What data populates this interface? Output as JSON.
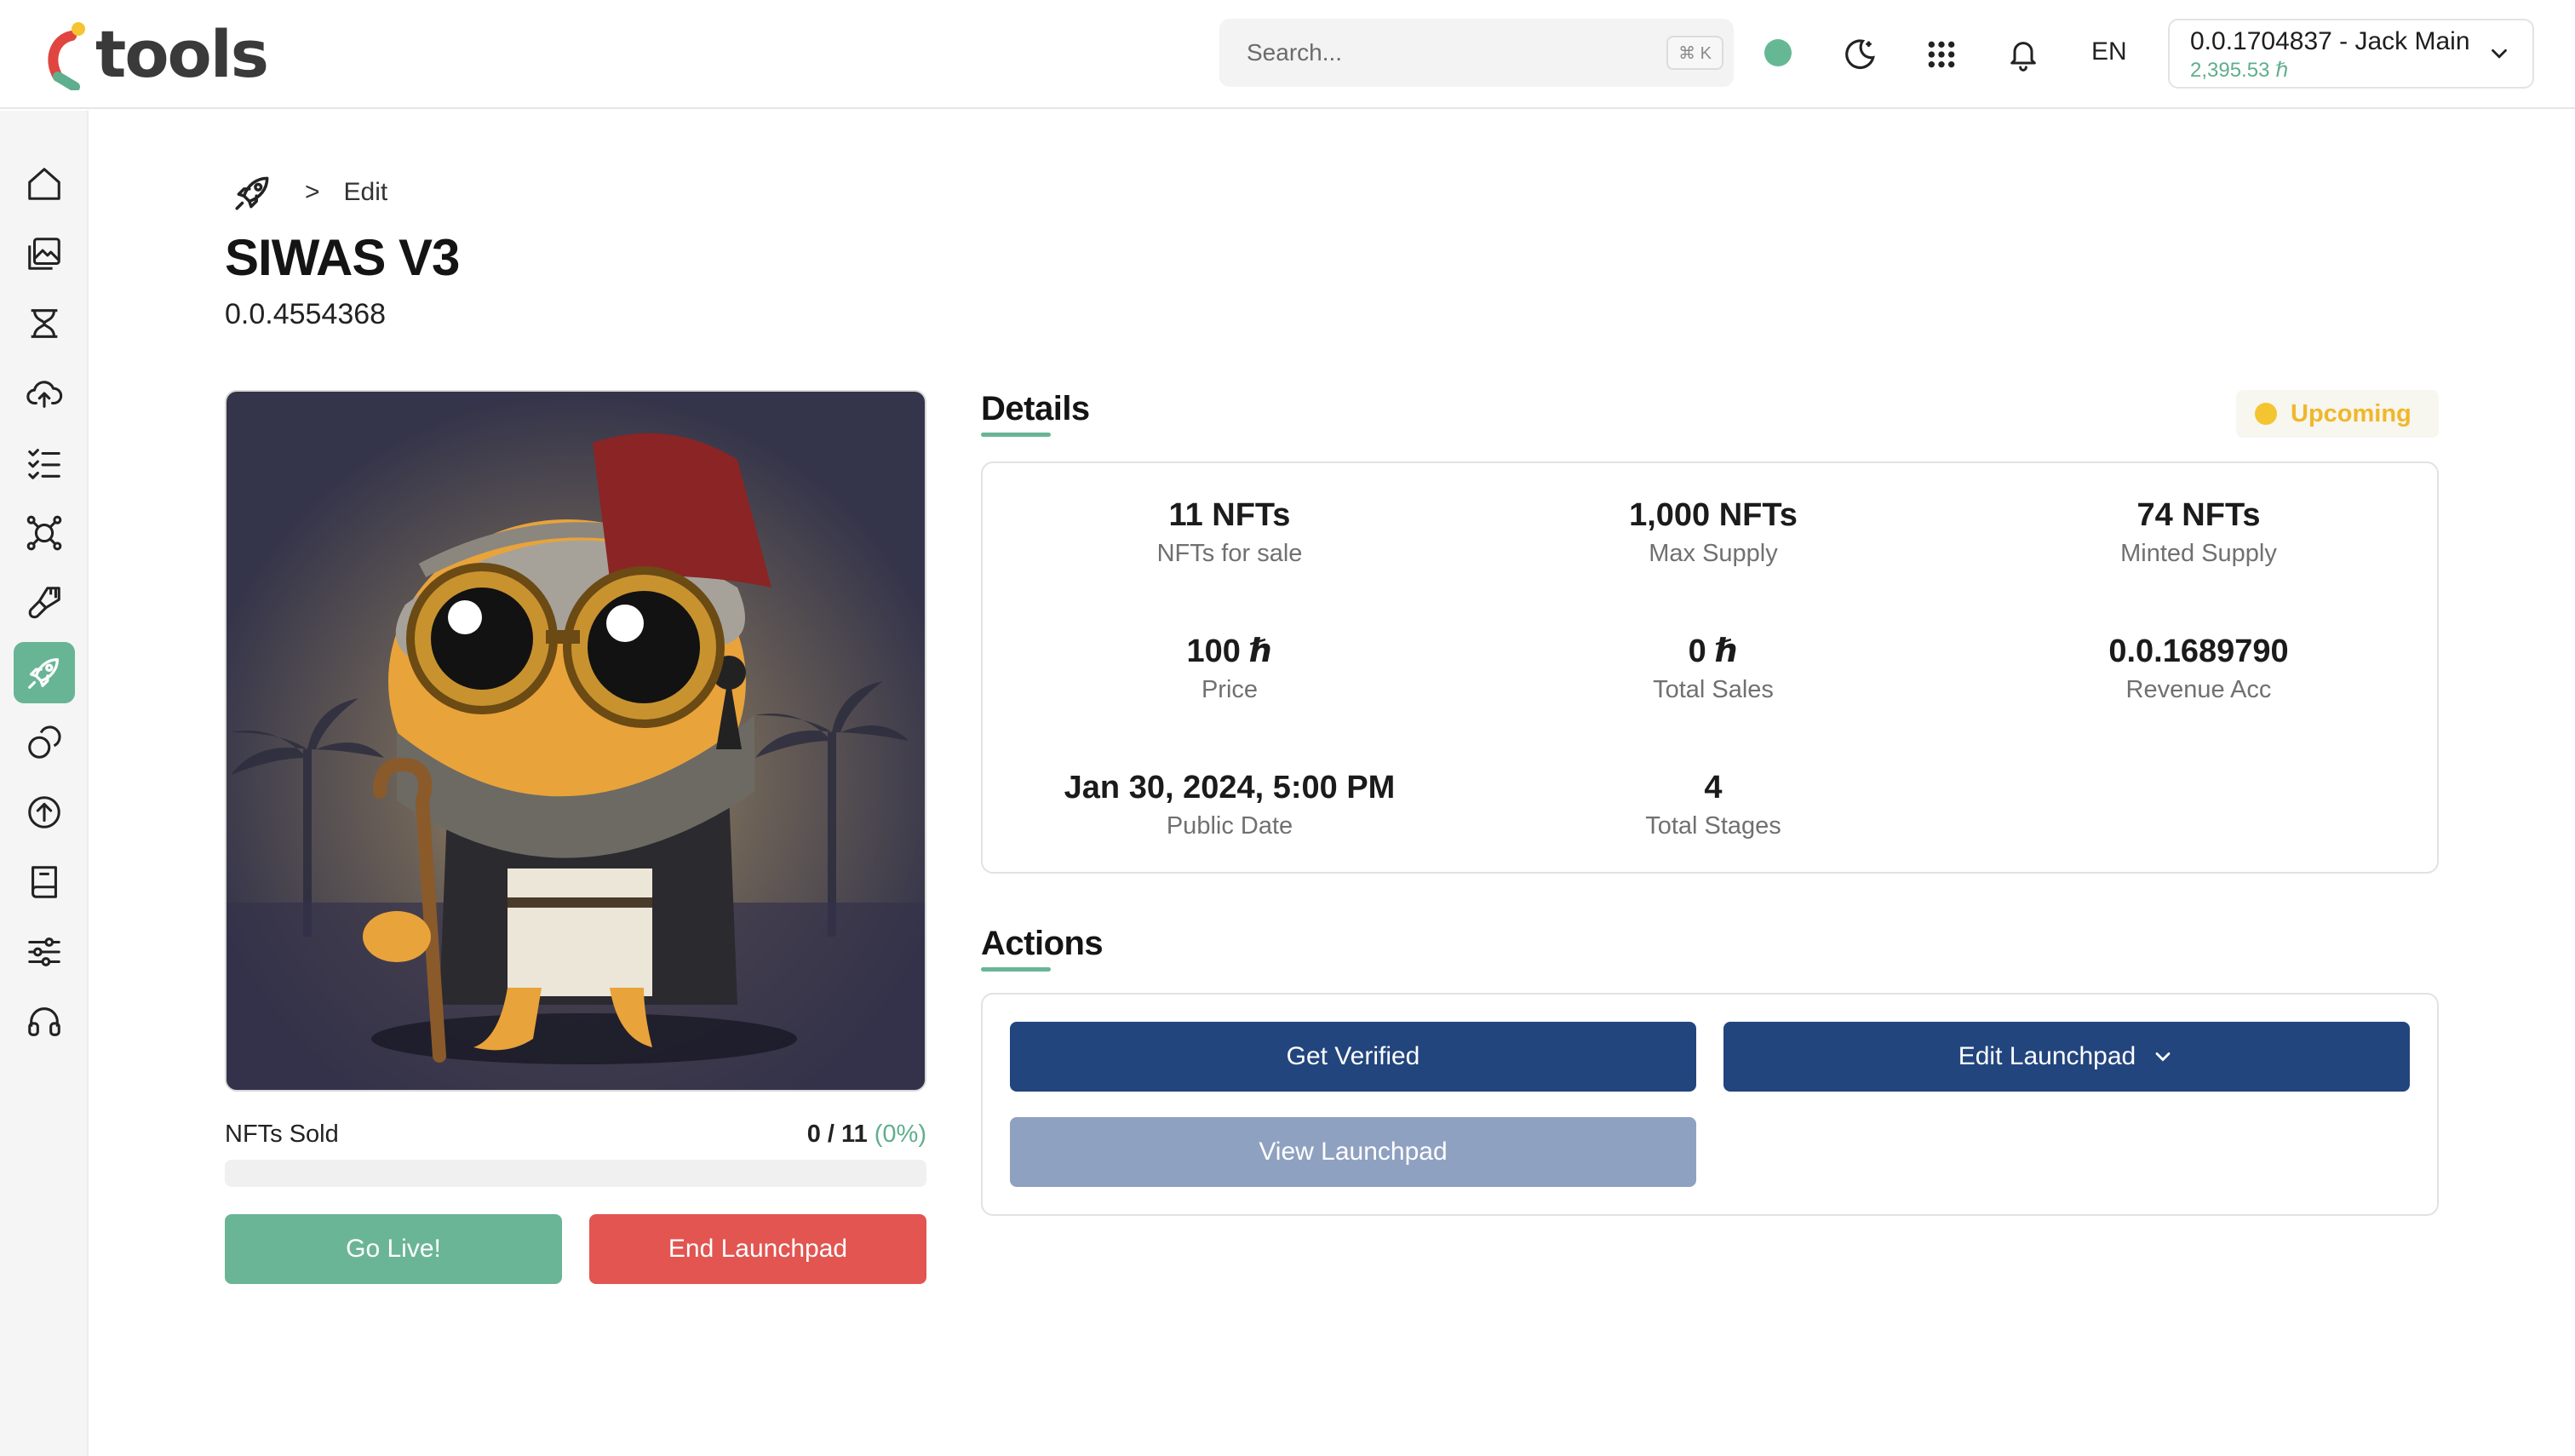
{
  "header": {
    "logo_text": "tools",
    "search_placeholder": "Search...",
    "search_shortcut": "⌘ K",
    "language": "EN",
    "account_name": "0.0.1704837 - Jack Main",
    "account_balance": "2,395.53 ℏ",
    "status_color": "#66b895"
  },
  "sidebar": {
    "items": [
      {
        "icon": "home-icon"
      },
      {
        "icon": "gallery-icon"
      },
      {
        "icon": "hourglass-icon"
      },
      {
        "icon": "cloud-upload-icon"
      },
      {
        "icon": "checklist-icon"
      },
      {
        "icon": "network-icon"
      },
      {
        "icon": "brush-icon"
      },
      {
        "icon": "rocket-icon",
        "active": true
      },
      {
        "icon": "coins-icon"
      },
      {
        "icon": "arrow-up-circle-icon"
      },
      {
        "icon": "book-icon"
      },
      {
        "icon": "sliders-icon"
      },
      {
        "icon": "headset-icon"
      }
    ]
  },
  "breadcrumb": {
    "separator": ">",
    "current": "Edit"
  },
  "page": {
    "title": "SIWAS V3",
    "subtitle": "0.0.4554368"
  },
  "sale": {
    "label": "NFTs Sold",
    "value": "0 / 11",
    "percent_text": "(0%)",
    "progress_fraction": 0
  },
  "buttons": {
    "go_live": "Go Live!",
    "end_launchpad": "End Launchpad",
    "get_verified": "Get Verified",
    "edit_launchpad": "Edit Launchpad",
    "view_launchpad": "View Launchpad"
  },
  "details": {
    "title": "Details",
    "status": "Upcoming",
    "status_color": "#f4c531",
    "stats": [
      {
        "value": "11 NFTs",
        "label": "NFTs for sale"
      },
      {
        "value": "1,000 NFTs",
        "label": "Max Supply"
      },
      {
        "value": "74 NFTs",
        "label": "Minted Supply"
      },
      {
        "value": "100 ℏ",
        "label": "Price"
      },
      {
        "value": "0 ℏ",
        "label": "Total Sales"
      },
      {
        "value": "0.0.1689790",
        "label": "Revenue Acc"
      },
      {
        "value": "Jan 30, 2024, 5:00 PM",
        "label": "Public Date"
      },
      {
        "value": "4",
        "label": "Total Stages"
      }
    ]
  },
  "actions": {
    "title": "Actions"
  },
  "colors": {
    "accent": "#68b596",
    "danger": "#e25551",
    "primary": "#22457e"
  }
}
